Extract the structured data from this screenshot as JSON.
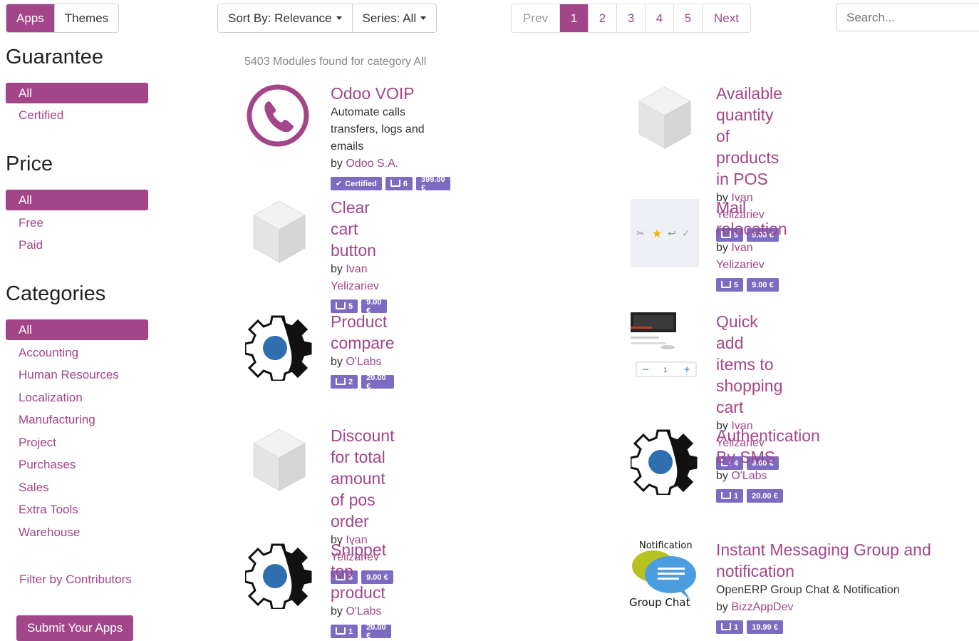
{
  "topbar": {
    "tabs": [
      {
        "label": "Apps",
        "active": true
      },
      {
        "label": "Themes",
        "active": false
      }
    ],
    "sort_label": "Sort By: Relevance",
    "series_label": "Series: All",
    "pager": {
      "prev": "Prev",
      "pages": [
        "1",
        "2",
        "3",
        "4",
        "5"
      ],
      "active": "1",
      "next": "Next"
    },
    "search_placeholder": "Search..."
  },
  "sidebar": {
    "guarantee": {
      "title": "Guarantee",
      "all": "All",
      "items": [
        "Certified"
      ]
    },
    "price": {
      "title": "Price",
      "all": "All",
      "items": [
        "Free",
        "Paid"
      ]
    },
    "categories": {
      "title": "Categories",
      "all": "All",
      "items": [
        "Accounting",
        "Human Resources",
        "Localization",
        "Manufacturing",
        "Project",
        "Purchases",
        "Sales",
        "Extra Tools",
        "Warehouse"
      ]
    },
    "contributors": "Filter by Contributors",
    "submit": "Submit Your Apps"
  },
  "accent_color": "#a24689",
  "badge_color": "#7c6bc1",
  "results_text": "5403 Modules found for category All",
  "modules": [
    {
      "title": "Odoo VOIP",
      "desc": "Automate calls transfers, logs and emails",
      "by": "by",
      "author": "Odoo S.A.",
      "certified": "Certified",
      "count": "6",
      "price": "399.00 €",
      "icon": "phone-icon"
    },
    {
      "title": "Available quantity of products in POS",
      "desc": "",
      "by": "by",
      "author": "Ivan Yelizariev",
      "count": "9",
      "price": "9.00 €",
      "icon": "cube-icon"
    },
    {
      "title": "Clear cart button",
      "desc": "",
      "by": "by",
      "author": "Ivan Yelizariev",
      "count": "5",
      "price": "9.00 €",
      "icon": "cube-icon"
    },
    {
      "title": "Mail relocation",
      "desc": "",
      "by": "by",
      "author": "Ivan Yelizariev",
      "count": "5",
      "price": "9.00 €",
      "icon": "mail-icons-thumbnail"
    },
    {
      "title": "Product compare",
      "desc": "",
      "by": "by",
      "author": "O'Labs",
      "count": "2",
      "price": "20.00 €",
      "icon": "gear-icon"
    },
    {
      "title": "Quick add items to shopping cart",
      "desc": "",
      "by": "by",
      "author": "Ivan Yelizariev",
      "count": "4",
      "price": "9.00 €",
      "icon": "cart-screenshot-thumbnail"
    },
    {
      "title": "Discount for total amount of pos order",
      "desc": "",
      "by": "by",
      "author": "Ivan Yelizariev",
      "count": "3",
      "price": "9.00 €",
      "icon": "cube-icon"
    },
    {
      "title": "Authentication By SMS",
      "desc": "",
      "by": "by",
      "author": "O'Labs",
      "count": "1",
      "price": "20.00 €",
      "icon": "gear-icon"
    },
    {
      "title": "Snippet top product",
      "desc": "",
      "by": "by",
      "author": "O'Labs",
      "count": "1",
      "price": "20.00 €",
      "icon": "gear-icon"
    },
    {
      "title": "Instant Messaging Group and notification",
      "desc": "OpenERP Group Chat & Notification",
      "by": "by",
      "author": "BizzAppDev",
      "count": "1",
      "price": "19.99 €",
      "icon": "chat-bubbles-icon",
      "icon_text_top": "Notification",
      "icon_text_bottom": "Group Chat"
    }
  ]
}
